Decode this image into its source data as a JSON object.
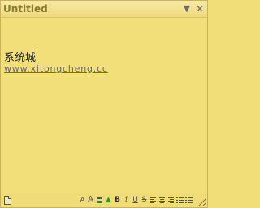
{
  "window": {
    "title": "Untitled",
    "menu_icon": "▼",
    "close_icon": "✕"
  },
  "note": {
    "line1": "系统城",
    "line2": "www.xitongcheng.cc"
  },
  "toolbar": {
    "font_smaller": "A",
    "font_larger": "A",
    "text_color": "A",
    "highlight": "▲",
    "bold": "B",
    "italic": "i",
    "underline": "U",
    "strikethrough": "S"
  },
  "colors": {
    "note_background": "#f3df7a",
    "title_text": "#8b7a2e",
    "link_text": "#6a6a6a"
  }
}
